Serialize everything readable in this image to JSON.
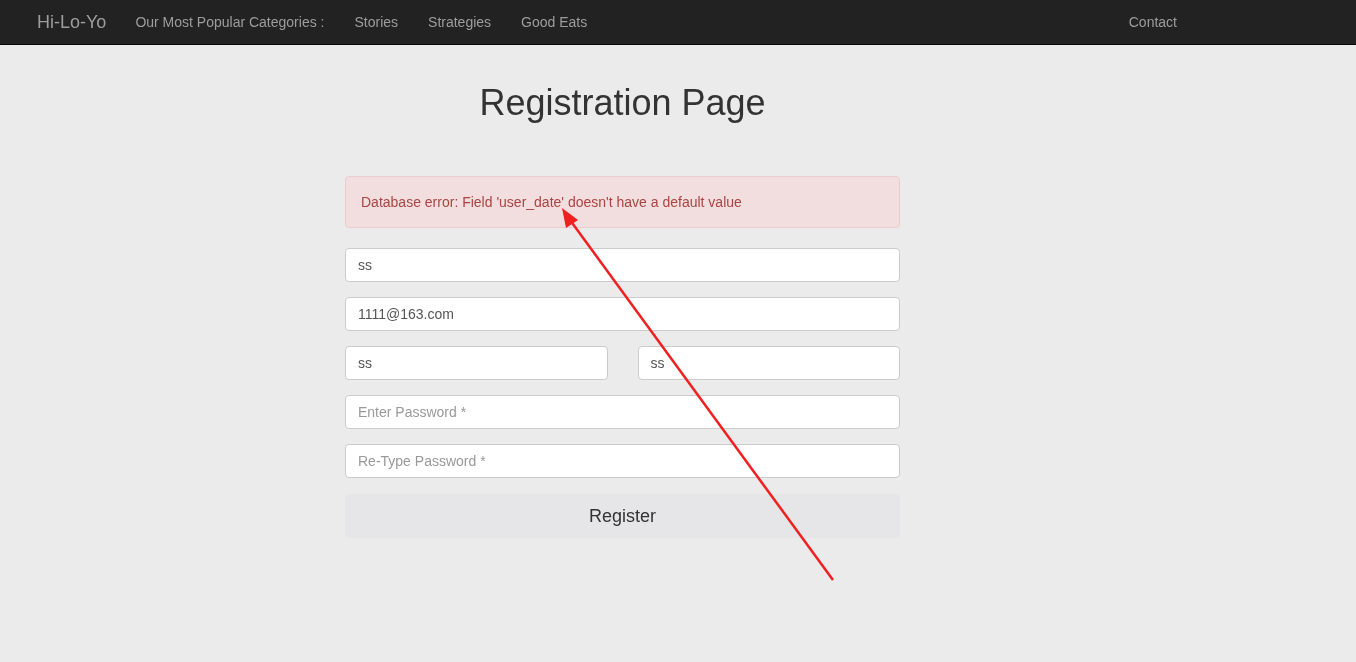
{
  "navbar": {
    "brand": "Hi-Lo-Yo",
    "categories_label": "Our Most Popular Categories :",
    "links": [
      {
        "label": "Stories"
      },
      {
        "label": "Strategies"
      },
      {
        "label": "Good Eats"
      }
    ],
    "right_link": "Contact"
  },
  "title": "Registration Page",
  "alert": {
    "message": "Database error: Field 'user_date' doesn't have a default value"
  },
  "form_rows": [
    [
      {
        "value": "ss"
      }
    ],
    [
      {
        "value": "1111@163.com"
      }
    ],
    [
      {
        "value": "ss"
      },
      {
        "value": "ss"
      }
    ],
    [
      {
        "placeholder": "Enter Password *"
      }
    ],
    [
      {
        "placeholder": "Re-Type Password *"
      }
    ]
  ],
  "submit_button": "Register",
  "annotation": {
    "kind": "arrow"
  }
}
